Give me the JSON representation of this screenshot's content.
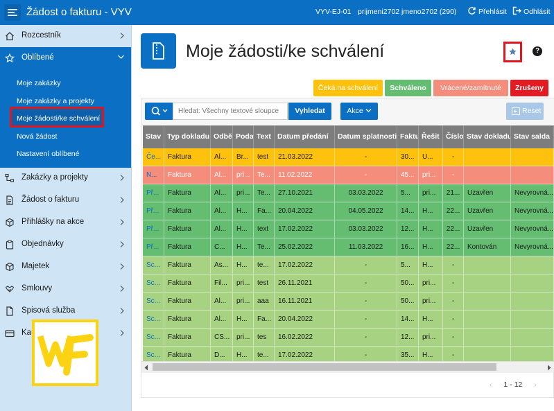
{
  "header": {
    "app_title": "Žádost o fakturu - VYV",
    "env": "VYV-EJ-01",
    "user": "prijmeni2702 jmeno2702 (290)",
    "switch_label": "Přehlásit",
    "logout_label": "Odhlásit"
  },
  "sidebar": {
    "items": [
      {
        "label": "Rozcestník",
        "icon": "home-icon"
      },
      {
        "label": "Oblíbené",
        "icon": "star-icon"
      },
      {
        "label": "Zakázky a projekty",
        "icon": "hierarchy-icon"
      },
      {
        "label": "Žádost o fakturu",
        "icon": "document-icon"
      },
      {
        "label": "Přihlášky na akce",
        "icon": "cube-icon"
      },
      {
        "label": "Objednávky",
        "icon": "clipboard-icon"
      },
      {
        "label": "Majetek",
        "icon": "box-icon"
      },
      {
        "label": "Smlouvy",
        "icon": "handshake-icon"
      },
      {
        "label": "Spisová služba",
        "icon": "file-icon"
      },
      {
        "label": "Karty a IPS",
        "icon": "card-icon"
      }
    ],
    "favorites": [
      "Moje zakázky",
      "Moje zakázky a projekty",
      "Moje žádosti/ke schválení",
      "Nová žádost",
      "Nastavení oblíbené"
    ],
    "logo_text": "WF"
  },
  "page": {
    "title": "Moje žádosti/ke schválení",
    "help": "?"
  },
  "legend": [
    {
      "label": "Čeká na schválení",
      "color": "#fec10e"
    },
    {
      "label": "Schváleno",
      "color": "#65bd72"
    },
    {
      "label": "Vrácené/zamítnuté",
      "color": "#f58d7d"
    },
    {
      "label": "Zrušeny",
      "color": "#e21c22"
    }
  ],
  "toolbar": {
    "search_placeholder": "Hledat: Všechny textové sloupce",
    "search_button": "Vyhledat",
    "actions_button": "Akce",
    "reset_button": "Reset"
  },
  "table": {
    "columns": [
      "Stav",
      "Typ dokladu",
      "Odbě",
      "Podat",
      "Text",
      "Datum předání",
      "Datum splatnosti",
      "Faktu",
      "Řešit",
      "Číslo",
      "Stav dokladu",
      "Stav salda"
    ],
    "rows": [
      {
        "status": "waiting",
        "cells": [
          "Če...",
          "Faktura",
          "Al...",
          "Br...",
          "test",
          "21.03.2022",
          "-",
          "30...",
          "U...",
          "-",
          "",
          ""
        ]
      },
      {
        "status": "returned",
        "cells": [
          "N...",
          "Faktura",
          "Al...",
          "pri...",
          "Te...",
          "11.02.2022",
          "-",
          "45...",
          "pri...",
          "-",
          "",
          ""
        ]
      },
      {
        "status": "approved",
        "cells": [
          "Př...",
          "Faktura",
          "Al...",
          "pri...",
          "Te...",
          "27.10.2021",
          "03.03.2022",
          "5...",
          "pri...",
          "21...",
          "Uzavřen",
          "Nevyrovná..."
        ]
      },
      {
        "status": "approved",
        "cells": [
          "Př...",
          "Faktura",
          "Al...",
          "H...",
          "Fa...",
          "20.04.2022",
          "04.05.2022",
          "14...",
          "H...",
          "22...",
          "Uzavřen",
          "Nevyrovná..."
        ]
      },
      {
        "status": "approved",
        "cells": [
          "Př...",
          "Faktura",
          "Al...",
          "H...",
          "text",
          "17.02.2022",
          "03.03.2022",
          "12...",
          "H...",
          "22...",
          "Uzavřen",
          "Nevyrovná..."
        ]
      },
      {
        "status": "approved",
        "cells": [
          "Př...",
          "Faktura",
          "C...",
          "H...",
          "Te...",
          "25.02.2022",
          "11.03.2022",
          "16...",
          "H...",
          "22...",
          "Kontován",
          "Nevyrovná..."
        ]
      },
      {
        "status": "done",
        "cells": [
          "Sc...",
          "Faktura",
          "As...",
          "H...",
          "te...",
          "17.02.2022",
          "-",
          "5...",
          "H...",
          "-",
          "",
          ""
        ]
      },
      {
        "status": "done",
        "cells": [
          "Sc...",
          "Faktura",
          "Fil...",
          "pri...",
          "test",
          "26.11.2021",
          "-",
          "50...",
          "pri...",
          "-",
          "",
          ""
        ]
      },
      {
        "status": "done",
        "cells": [
          "Sc...",
          "Faktura",
          "Al...",
          "pri...",
          "aaa",
          "16.11.2021",
          "-",
          "50...",
          "pri...",
          "-",
          "",
          ""
        ]
      },
      {
        "status": "done",
        "cells": [
          "Sc...",
          "Faktura",
          "Al...",
          "H...",
          "Fa...",
          "20.04.2022",
          "-",
          "14...",
          "H...",
          "-",
          "",
          ""
        ]
      },
      {
        "status": "done",
        "cells": [
          "Sc...",
          "Faktura",
          "CS...",
          "pri...",
          "tes",
          "16.02.2022",
          "-",
          "12...",
          "pri...",
          "-",
          "",
          ""
        ]
      },
      {
        "status": "done",
        "cells": [
          "Sc...",
          "Faktura",
          "D...",
          "H...",
          "te...",
          "17.02.2022",
          "-",
          "35...",
          "H...",
          "-",
          "",
          ""
        ]
      }
    ]
  },
  "pagination": {
    "range": "1 - 12"
  },
  "colors": {
    "waiting": "#fec10e",
    "returned": "#f58d7d",
    "approved": "#65bd72",
    "done": "#a6d281",
    "accent": "#0b6fc4"
  }
}
